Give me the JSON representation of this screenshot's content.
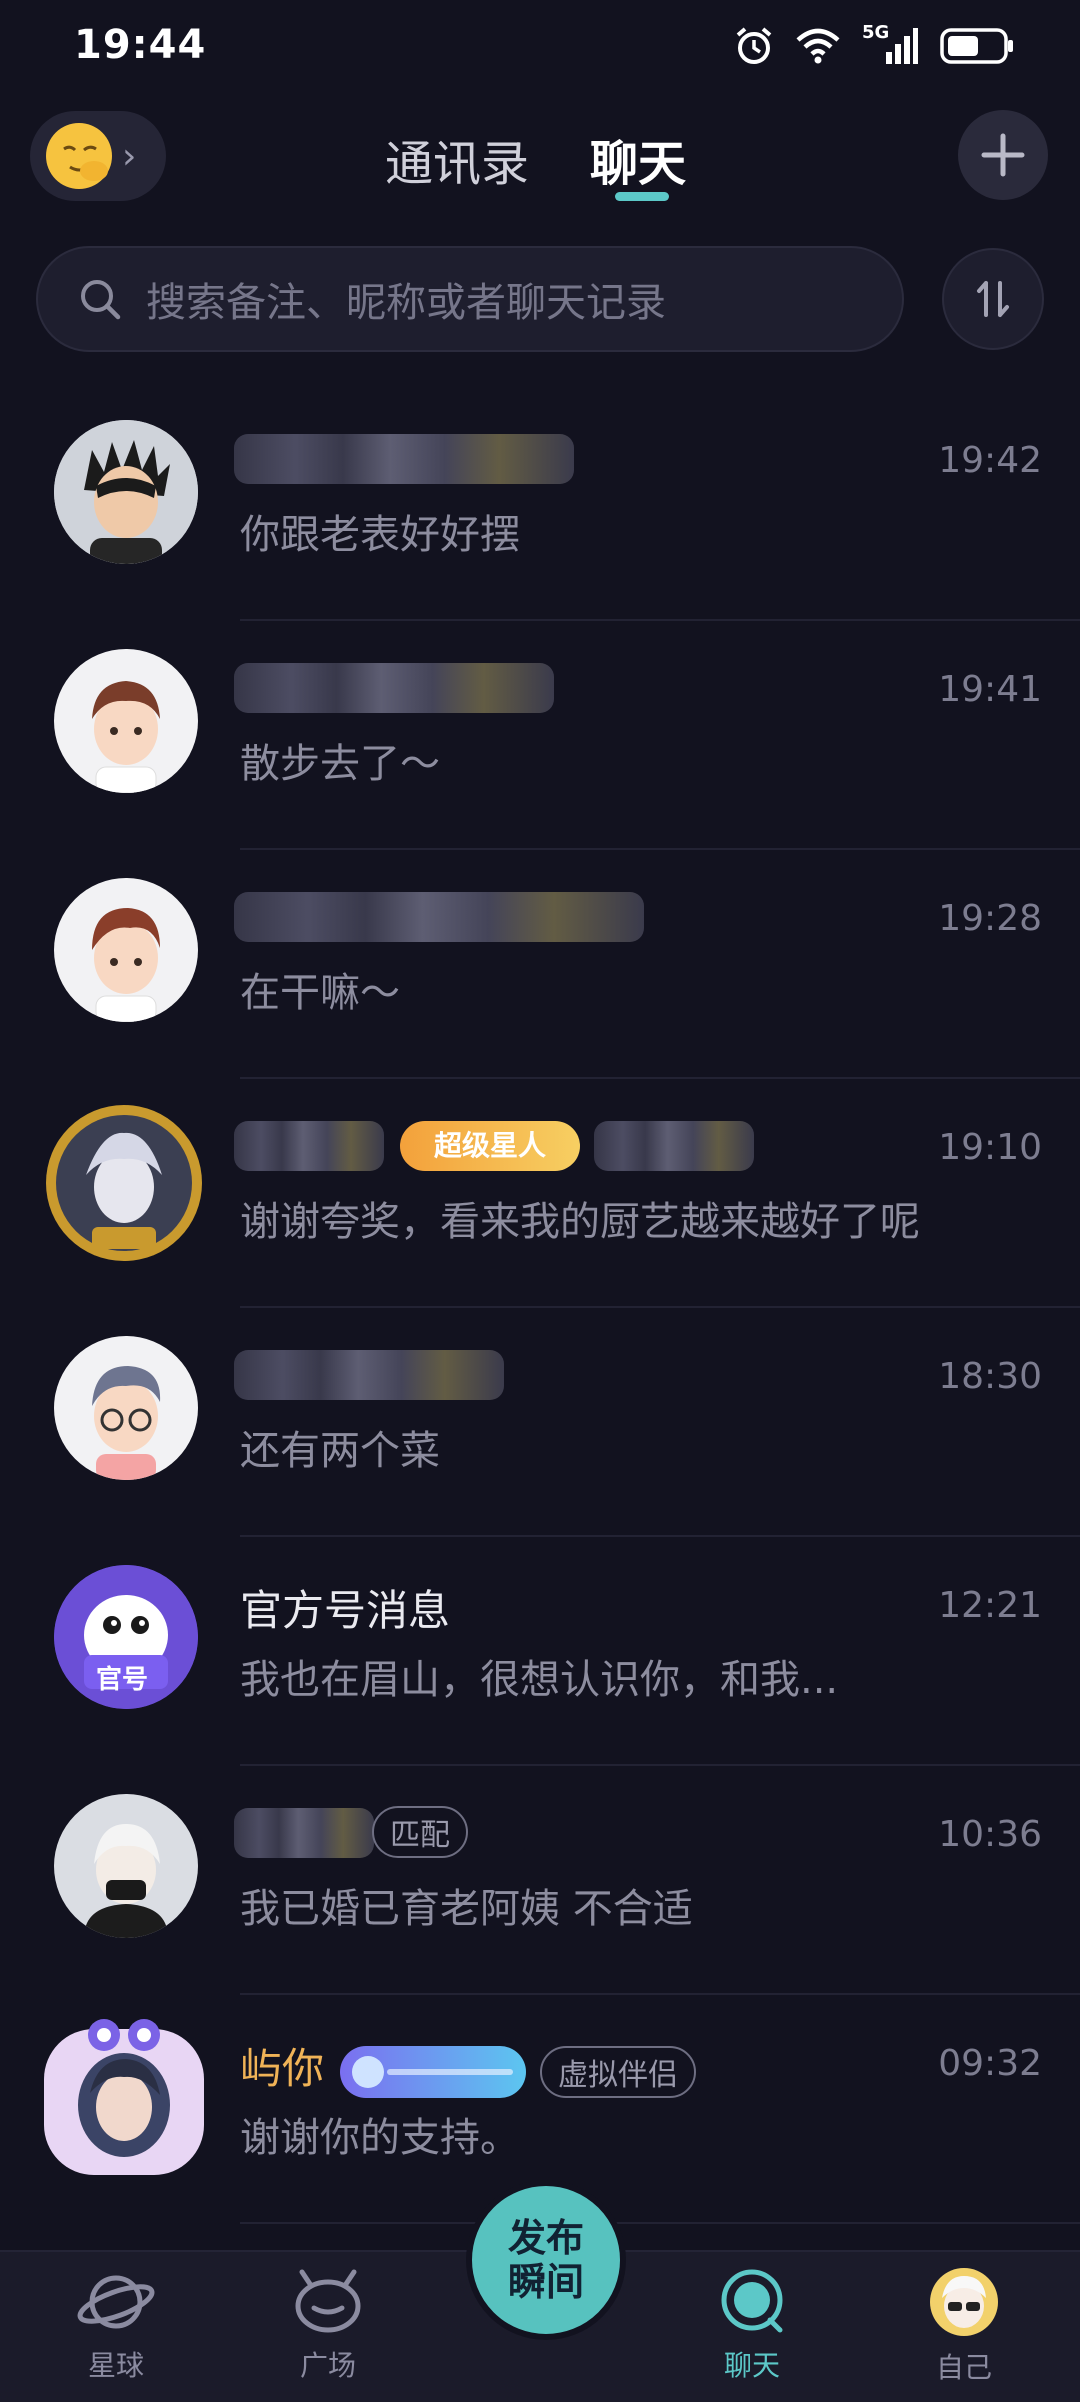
{
  "status_bar": {
    "time": "19:44",
    "network": "5G"
  },
  "header": {
    "tabs": [
      {
        "label": "通讯录",
        "active": false
      },
      {
        "label": "聊天",
        "active": true
      }
    ],
    "accent_color": "#5cc8c8"
  },
  "search": {
    "placeholder": "搜索备注、昵称或者聊天记录"
  },
  "chats": [
    {
      "name": "",
      "name_blurred": true,
      "preview": "你跟老表好好摆",
      "time": "19:42"
    },
    {
      "name": "",
      "name_blurred": true,
      "preview": "散步去了～",
      "time": "19:41"
    },
    {
      "name": "",
      "name_blurred": true,
      "preview": "在干嘛～",
      "time": "19:28"
    },
    {
      "name": "",
      "name_blurred": true,
      "badge": "超级星人",
      "preview": "谢谢夸奖，看来我的厨艺越来越好了呢",
      "time": "19:10"
    },
    {
      "name": "",
      "name_blurred": true,
      "preview": "还有两个菜",
      "time": "18:30"
    },
    {
      "name": "官方号消息",
      "avatar_text": "官号",
      "preview": "我也在眉山，很想认识你，和我...",
      "time": "12:21"
    },
    {
      "name": "",
      "name_blurred": true,
      "tag": "匹配",
      "preview": "我已婚已育老阿姨 不合适",
      "time": "10:36"
    },
    {
      "name": "屿你",
      "tag": "虚拟伴侣",
      "preview": "谢谢你的支持。",
      "time": "09:32"
    }
  ],
  "bottom_nav": {
    "items": [
      {
        "label": "星球",
        "icon": "planet-icon"
      },
      {
        "label": "广场",
        "icon": "plaza-icon"
      },
      {
        "label": "聊天",
        "icon": "chat-icon",
        "active": true
      },
      {
        "label": "自己",
        "icon": "profile-avatar"
      }
    ],
    "publish_label": "发布瞬间"
  }
}
